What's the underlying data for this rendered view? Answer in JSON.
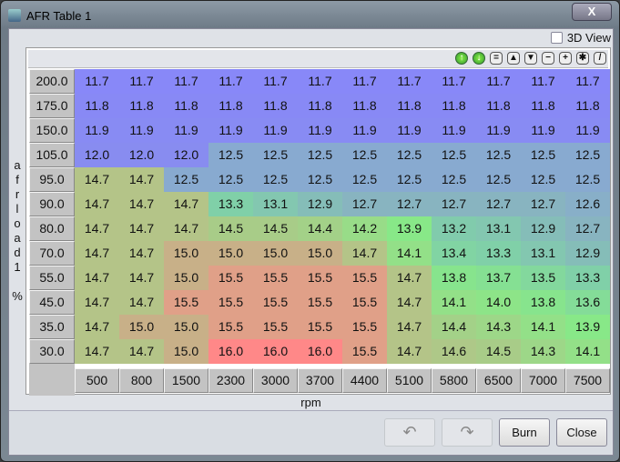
{
  "window": {
    "title": "AFR Table 1",
    "close_label": "X"
  },
  "view3d_label": "3D View",
  "toolbar": {
    "icons": [
      "rotate-up-icon",
      "rotate-down-icon",
      "equals-icon",
      "increment-icon",
      "decrement-icon",
      "minus-icon",
      "plus-icon",
      "scale-icon",
      "color-icon"
    ],
    "glyphs": [
      "↑",
      "↓",
      "=",
      "▲",
      "▼",
      "−",
      "+",
      "✱",
      "/"
    ]
  },
  "y_axis_label": [
    "a",
    "f",
    "r",
    "l",
    "o",
    "a",
    "d",
    "1",
    "",
    "%"
  ],
  "x_axis_label": "rpm",
  "rows": [
    "200.0",
    "175.0",
    "150.0",
    "105.0",
    "95.0",
    "90.0",
    "80.0",
    "70.0",
    "55.0",
    "45.0",
    "35.0",
    "30.0"
  ],
  "cols": [
    "500",
    "800",
    "1500",
    "2300",
    "3000",
    "3700",
    "4400",
    "5100",
    "5800",
    "6500",
    "7000",
    "7500"
  ],
  "values": [
    [
      "11.7",
      "11.7",
      "11.7",
      "11.7",
      "11.7",
      "11.7",
      "11.7",
      "11.7",
      "11.7",
      "11.7",
      "11.7",
      "11.7"
    ],
    [
      "11.8",
      "11.8",
      "11.8",
      "11.8",
      "11.8",
      "11.8",
      "11.8",
      "11.8",
      "11.8",
      "11.8",
      "11.8",
      "11.8"
    ],
    [
      "11.9",
      "11.9",
      "11.9",
      "11.9",
      "11.9",
      "11.9",
      "11.9",
      "11.9",
      "11.9",
      "11.9",
      "11.9",
      "11.9"
    ],
    [
      "12.0",
      "12.0",
      "12.0",
      "12.5",
      "12.5",
      "12.5",
      "12.5",
      "12.5",
      "12.5",
      "12.5",
      "12.5",
      "12.5"
    ],
    [
      "14.7",
      "14.7",
      "12.5",
      "12.5",
      "12.5",
      "12.5",
      "12.5",
      "12.5",
      "12.5",
      "12.5",
      "12.5",
      "12.5"
    ],
    [
      "14.7",
      "14.7",
      "14.7",
      "13.3",
      "13.1",
      "12.9",
      "12.7",
      "12.7",
      "12.7",
      "12.7",
      "12.7",
      "12.6"
    ],
    [
      "14.7",
      "14.7",
      "14.7",
      "14.5",
      "14.5",
      "14.4",
      "14.2",
      "13.9",
      "13.2",
      "13.1",
      "12.9",
      "12.7"
    ],
    [
      "14.7",
      "14.7",
      "15.0",
      "15.0",
      "15.0",
      "15.0",
      "14.7",
      "14.1",
      "13.4",
      "13.3",
      "13.1",
      "12.9"
    ],
    [
      "14.7",
      "14.7",
      "15.0",
      "15.5",
      "15.5",
      "15.5",
      "15.5",
      "14.7",
      "13.8",
      "13.7",
      "13.5",
      "13.3"
    ],
    [
      "14.7",
      "14.7",
      "15.5",
      "15.5",
      "15.5",
      "15.5",
      "15.5",
      "14.7",
      "14.1",
      "14.0",
      "13.8",
      "13.6"
    ],
    [
      "14.7",
      "15.0",
      "15.0",
      "15.5",
      "15.5",
      "15.5",
      "15.5",
      "14.7",
      "14.4",
      "14.3",
      "14.1",
      "13.9"
    ],
    [
      "14.7",
      "14.7",
      "15.0",
      "16.0",
      "16.0",
      "16.0",
      "15.5",
      "14.7",
      "14.6",
      "14.5",
      "14.3",
      "14.1"
    ]
  ],
  "buttons": {
    "undo": "↶",
    "redo": "↷",
    "burn": "Burn",
    "close": "Close"
  }
}
